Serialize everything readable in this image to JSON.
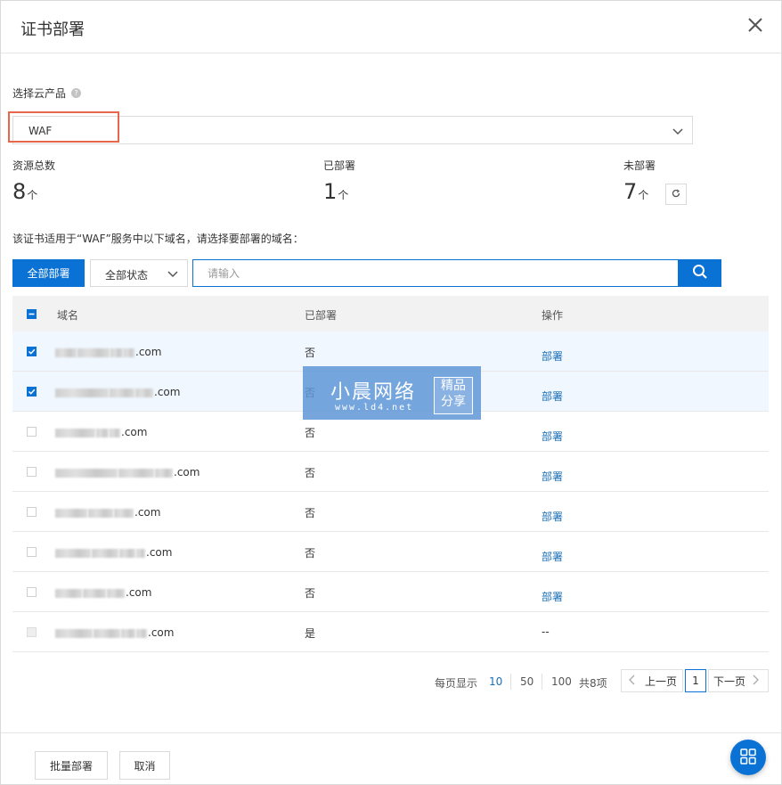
{
  "dialog": {
    "title": "证书部署"
  },
  "product": {
    "label": "选择云产品",
    "help": "?",
    "selected": "WAF"
  },
  "stats": {
    "total": {
      "label": "资源总数",
      "value": "8",
      "unit": "个"
    },
    "deployed": {
      "label": "已部署",
      "value": "1",
      "unit": "个"
    },
    "undeployed": {
      "label": "未部署",
      "value": "7",
      "unit": "个"
    }
  },
  "description": "该证书适用于“WAF”服务中以下域名，请选择要部署的域名：",
  "toolbar": {
    "deploy_all": "全部部署",
    "status_filter": "全部状态",
    "search_placeholder": "请输入"
  },
  "table": {
    "headers": {
      "domain": "域名",
      "deployed": "已部署",
      "action": "操作"
    },
    "rows": [
      {
        "domain_suffix": ".com",
        "deployed": "否",
        "action": "部署",
        "checked": true
      },
      {
        "domain_suffix": ".com",
        "deployed": "否",
        "action": "部署",
        "checked": true
      },
      {
        "domain_suffix": ".com",
        "deployed": "否",
        "action": "部署",
        "checked": false
      },
      {
        "domain_suffix": ".com",
        "deployed": "否",
        "action": "部署",
        "checked": false
      },
      {
        "domain_suffix": ".com",
        "deployed": "否",
        "action": "部署",
        "checked": false
      },
      {
        "domain_suffix": ".com",
        "deployed": "否",
        "action": "部署",
        "checked": false
      },
      {
        "domain_suffix": ".com",
        "deployed": "否",
        "action": "部署",
        "checked": false
      },
      {
        "domain_suffix": ".com",
        "deployed": "是",
        "action": "--",
        "checked": false
      }
    ]
  },
  "pagination": {
    "page_size_label": "每页显示",
    "sizes": [
      "10",
      "50",
      "100"
    ],
    "active_size": "10",
    "total": "共8项",
    "prev": "上一页",
    "current": "1",
    "next": "下一页"
  },
  "watermark": {
    "main": "小晨网络",
    "url": "www.ld4.net",
    "badge_top": "精品",
    "badge_bottom": "分享"
  },
  "footer": {
    "batch_deploy": "批量部署",
    "cancel": "取消"
  },
  "colors": {
    "primary": "#0b72d5",
    "link": "#1a6fb5",
    "highlight": "#e8674a"
  }
}
